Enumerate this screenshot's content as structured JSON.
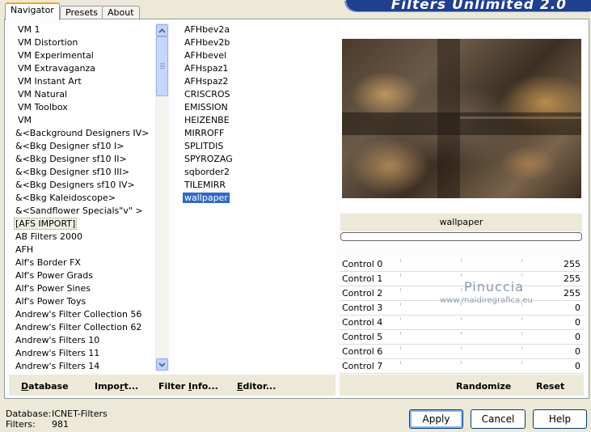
{
  "banner": {
    "title": "Filters Unlimited 2.0"
  },
  "tabs": [
    {
      "label": "Navigator",
      "active": true
    },
    {
      "label": "Presets",
      "active": false
    },
    {
      "label": "About",
      "active": false
    }
  ],
  "categories": [
    "VM 1",
    "VM Distortion",
    "VM Experimental",
    "VM Extravaganza",
    "VM Instant Art",
    "VM Natural",
    "VM Toolbox",
    "VM",
    "&<Background Designers IV>",
    "&<Bkg Designer sf10 I>",
    "&<Bkg Designer sf10 II>",
    "&<Bkg Designer sf10 III>",
    "&<Bkg Designers sf10 IV>",
    "&<Bkg Kaleidoscope>",
    "&<Sandflower Specials\"v\" >",
    "[AFS IMPORT]",
    "AB Filters 2000",
    "AFH",
    "Alf's Border FX",
    "Alf's Power Grads",
    "Alf's Power Sines",
    "Alf's Power Toys",
    "Andrew's Filter Collection 56",
    "Andrew's Filter Collection 62",
    "Andrew's Filters 10",
    "Andrew's Filters 11",
    "Andrew's Filters 14"
  ],
  "selected_category": "[AFS IMPORT]",
  "filters": [
    "AFHbev2a",
    "AFHbev2b",
    "AFHbevel",
    "AFHspaz1",
    "AFHspaz2",
    "CRISCROS",
    "EMISSION",
    "HEIZENBE",
    "MIRROFF",
    "SPLITDIS",
    "SPYROZAG",
    "sqborder2",
    "TILEMIRR",
    "wallpaper"
  ],
  "selected_filter": "wallpaper",
  "filter_name": "wallpaper",
  "controls": [
    {
      "label": "Control 0",
      "value": "255"
    },
    {
      "label": "Control 1",
      "value": "255"
    },
    {
      "label": "Control 2",
      "value": "255"
    },
    {
      "label": "Control 3",
      "value": "0"
    },
    {
      "label": "Control 4",
      "value": "0"
    },
    {
      "label": "Control 5",
      "value": "0"
    },
    {
      "label": "Control 6",
      "value": "0"
    },
    {
      "label": "Control 7",
      "value": "0"
    }
  ],
  "watermark": {
    "line1": "Pinuccia",
    "line2": "www.maidiregrafica.eu"
  },
  "bottom_buttons": {
    "database": {
      "u": "D",
      "rest": "atabase"
    },
    "import": {
      "pre": "Impo",
      "u": "r",
      "rest": "t..."
    },
    "filter_info": {
      "pre": "Filter ",
      "u": "I",
      "rest": "nfo..."
    },
    "editor": {
      "u": "E",
      "rest": "ditor..."
    },
    "randomize": "Randomize",
    "reset": "Reset"
  },
  "footer": {
    "database_label": "Database:",
    "database_value": "ICNET-Filters",
    "filters_label": "Filters:",
    "filters_value": "981"
  },
  "dialog_buttons": {
    "apply": "Apply",
    "cancel": "Cancel",
    "help": "Help"
  }
}
